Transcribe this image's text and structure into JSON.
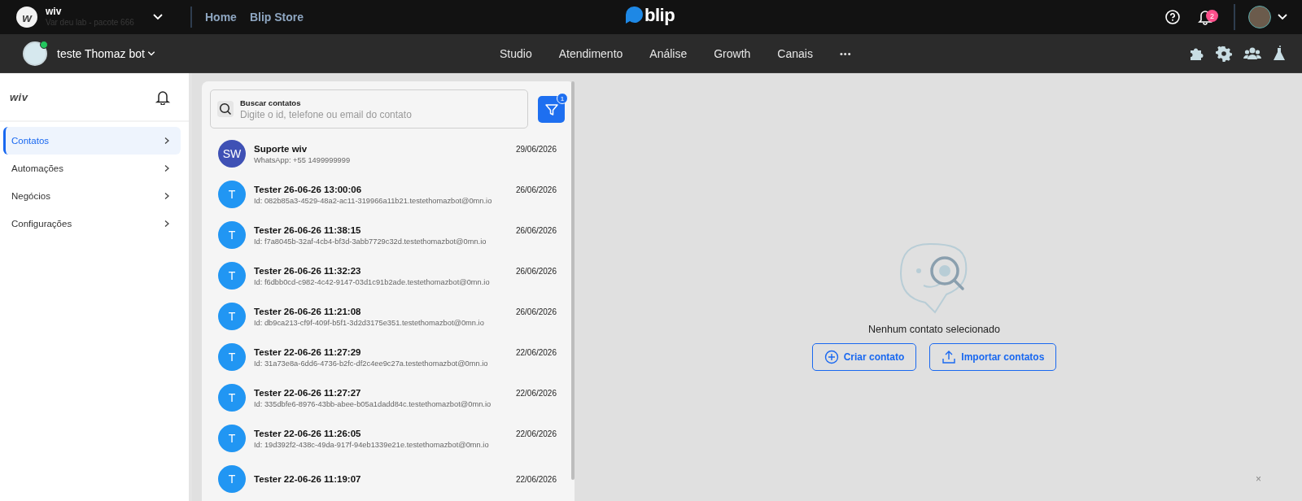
{
  "top_bar": {
    "account": {
      "logo": "w",
      "name": "wiv",
      "subtitle": "Var deu lab - pacote 666"
    },
    "links": [
      "Home",
      "Blip Store"
    ],
    "brand": "blip",
    "notifications_badge": "2"
  },
  "bot_bar": {
    "bot_name": "teste Thomaz bot",
    "online": true,
    "nav": [
      "Studio",
      "Atendimento",
      "Análise",
      "Growth",
      "Canais"
    ],
    "more": "•••"
  },
  "sidebar": {
    "logo": "wiv",
    "items": [
      {
        "label": "Contatos",
        "selected": true
      },
      {
        "label": "Automações",
        "selected": false
      },
      {
        "label": "Negócios",
        "selected": false
      },
      {
        "label": "Configurações",
        "selected": false
      }
    ]
  },
  "contacts": {
    "search": {
      "label": "Buscar contatos",
      "placeholder": "Digite o id, telefone ou email do contato"
    },
    "filter_badge": "1",
    "items": [
      {
        "initials": "SW",
        "color": "#3f51b5",
        "name": "Suporte wiv",
        "detail": "WhatsApp: +55 1499999999",
        "date": "29/06/2026"
      },
      {
        "initials": "T",
        "color": "#2196f3",
        "name": "Tester 26-06-26 13:00:06",
        "detail": "Id: 082b85a3-4529-48a2-ac11-319966a11b21.testethomazbot@0mn.io",
        "date": "26/06/2026"
      },
      {
        "initials": "T",
        "color": "#2196f3",
        "name": "Tester 26-06-26 11:38:15",
        "detail": "Id: f7a8045b-32af-4cb4-bf3d-3abb7729c32d.testethomazbot@0mn.io",
        "date": "26/06/2026"
      },
      {
        "initials": "T",
        "color": "#2196f3",
        "name": "Tester 26-06-26 11:32:23",
        "detail": "Id: f6dbb0cd-c982-4c42-9147-03d1c91b2ade.testethomazbot@0mn.io",
        "date": "26/06/2026"
      },
      {
        "initials": "T",
        "color": "#2196f3",
        "name": "Tester 26-06-26 11:21:08",
        "detail": "Id: db9ca213-cf9f-409f-b5f1-3d2d3175e351.testethomazbot@0mn.io",
        "date": "26/06/2026"
      },
      {
        "initials": "T",
        "color": "#2196f3",
        "name": "Tester 22-06-26 11:27:29",
        "detail": "Id: 31a73e8a-6dd6-4736-b2fc-df2c4ee9c27a.testethomazbot@0mn.io",
        "date": "22/06/2026"
      },
      {
        "initials": "T",
        "color": "#2196f3",
        "name": "Tester 22-06-26 11:27:27",
        "detail": "Id: 335dbfe6-8976-43bb-abee-b05a1dadd84c.testethomazbot@0mn.io",
        "date": "22/06/2026"
      },
      {
        "initials": "T",
        "color": "#2196f3",
        "name": "Tester 22-06-26 11:26:05",
        "detail": "Id: 19d392f2-438c-49da-917f-94eb1339e21e.testethomazbot@0mn.io",
        "date": "22/06/2026"
      },
      {
        "initials": "T",
        "color": "#2196f3",
        "name": "Tester 22-06-26 11:19:07",
        "date": "22/06/2026"
      }
    ]
  },
  "empty_state": {
    "message": "Nenhum contato selecionado",
    "buttons": [
      {
        "kind": "create",
        "label": "Criar contato"
      },
      {
        "kind": "import",
        "label": "Importar contatos"
      }
    ]
  },
  "close_label": "×"
}
